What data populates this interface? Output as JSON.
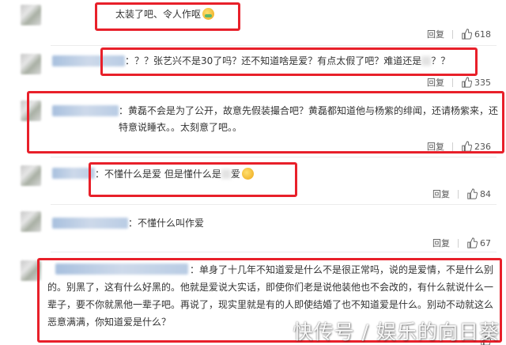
{
  "comments": [
    {
      "text_prefix": "",
      "text": "太装了吧、令人作呕",
      "emoji": "sick-face",
      "reply_label": "回复",
      "likes": "618"
    },
    {
      "text": "：？？张艺兴不是30了吗？还不知道啥是爱？有点太假了吧？难道还是",
      "text_tail": "？？",
      "reply_label": "回复",
      "likes": "335"
    },
    {
      "text": "：黄磊不会是为了公开，故意先假装撮合吧？黄磊都知道他与杨紫的绯闻，还请杨紫来，还特意说睡衣。。太刻意了吧。。",
      "reply_label": "回复",
      "likes": "236"
    },
    {
      "text": "：不懂什么是爱 但是懂什么是",
      "text_tail": "爱",
      "emoji": "smirk-face",
      "reply_label": "回复",
      "likes": "84"
    },
    {
      "text": "：不懂什么叫作爱",
      "reply_label": "回复",
      "likes": "67"
    },
    {
      "text": "：单身了十几年不知道爱是什么不是很正常吗，说的是爱情，不是什么别的。别黑了，这有什么好黑的。他就是爱说大实话，即使你们老是说他装他也不会改的，有什么就说什么一辈子，要不你就黑他一辈子吧。再说了，现实里就是有的人即使结婚了也不知道爱是什么。别动不动就这么恶意满满，你知道爱是什么？",
      "reply_label": "回复",
      "likes": "..."
    }
  ],
  "watermark": "快传号 / 娱乐的向日葵",
  "colors": {
    "highlight_box": "#e8202a",
    "text": "#333333",
    "meta": "#555555"
  }
}
